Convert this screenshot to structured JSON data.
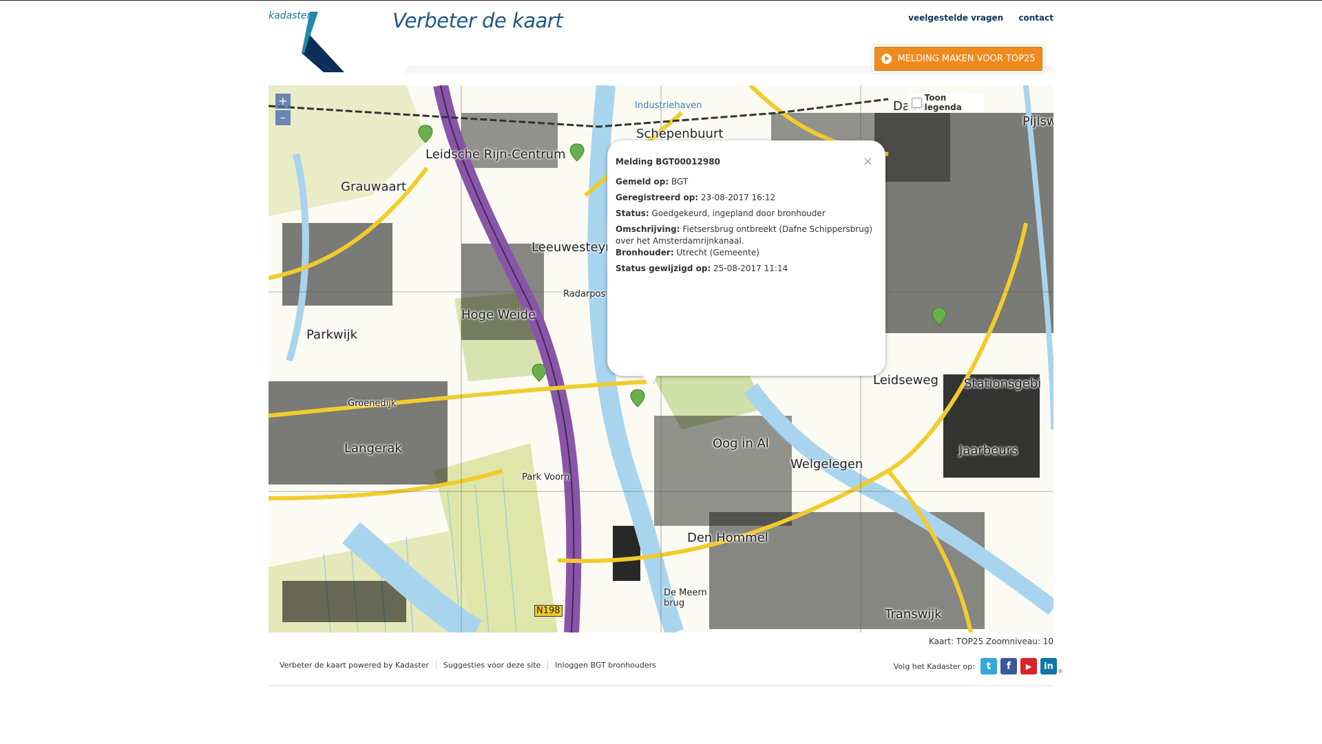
{
  "header": {
    "logo_text": "kadaster",
    "site_title": "Verbeter de kaart",
    "links": [
      {
        "label": "veelgestelde vragen"
      },
      {
        "label": "contact"
      }
    ],
    "report_button": "MELDING MAKEN VOOR TOP25"
  },
  "map": {
    "zoom_in": "+",
    "zoom_out": "–",
    "legend_toggle": "Toon legenda",
    "place_labels": [
      "Leidsche Rijn-Centrum",
      "Grauwaart",
      "Leeuwesteyn",
      "Hoge Weide",
      "Parkwijk",
      "Langerak",
      "Groenedijk",
      "Park Voorn",
      "Schepenbuurt",
      "Oog in Al",
      "Welgelegen",
      "Leidseweg",
      "Stationsgebi",
      "Jaarbeurs",
      "Den Hommel",
      "Transwijk",
      "De Meern brug",
      "Daals",
      "Pijlsw",
      "Industriehaven",
      "Radarpos",
      "N198"
    ],
    "info_text": "Kaart: TOP25 Zoomniveau: 10",
    "colors": {
      "water": "#a9d4ee",
      "motorway": "#8a55a8",
      "road": "#f2cc2c",
      "land": "#e5e8b8",
      "built": "#111111"
    }
  },
  "popup": {
    "title": "Melding BGT00012980",
    "close": "×",
    "fields": [
      {
        "label": "Gemeld op:",
        "value": "BGT"
      },
      {
        "label": "Geregistreerd op:",
        "value": "23-08-2017 16:12"
      },
      {
        "label": "Status:",
        "value": "Goedgekeurd, ingepland door bronhouder"
      },
      {
        "label": "Omschrijving:",
        "value": "Fietsersbrug ontbreekt (Dafne Schippersbrug) over het Amsterdamrijnkanaal."
      },
      {
        "label": "Bronhouder:",
        "value": "Utrecht (Gemeente)"
      },
      {
        "label": "Status gewijzigd op:",
        "value": "25-08-2017 11:14"
      }
    ]
  },
  "footer": {
    "links": [
      {
        "label": "Verbeter de kaart powered by Kadaster"
      },
      {
        "label": "Suggesties voor deze site"
      },
      {
        "label": "Inloggen BGT bronhouders"
      }
    ],
    "social_label": "Volg het Kadaster op:",
    "social": [
      {
        "name": "twitter",
        "glyph": "t",
        "color": "#33a8e0"
      },
      {
        "name": "facebook",
        "glyph": "f",
        "color": "#3b5998"
      },
      {
        "name": "youtube",
        "glyph": "▶",
        "color": "#d9252a"
      },
      {
        "name": "linkedin",
        "glyph": "in",
        "color": "#0e76a8"
      }
    ]
  }
}
